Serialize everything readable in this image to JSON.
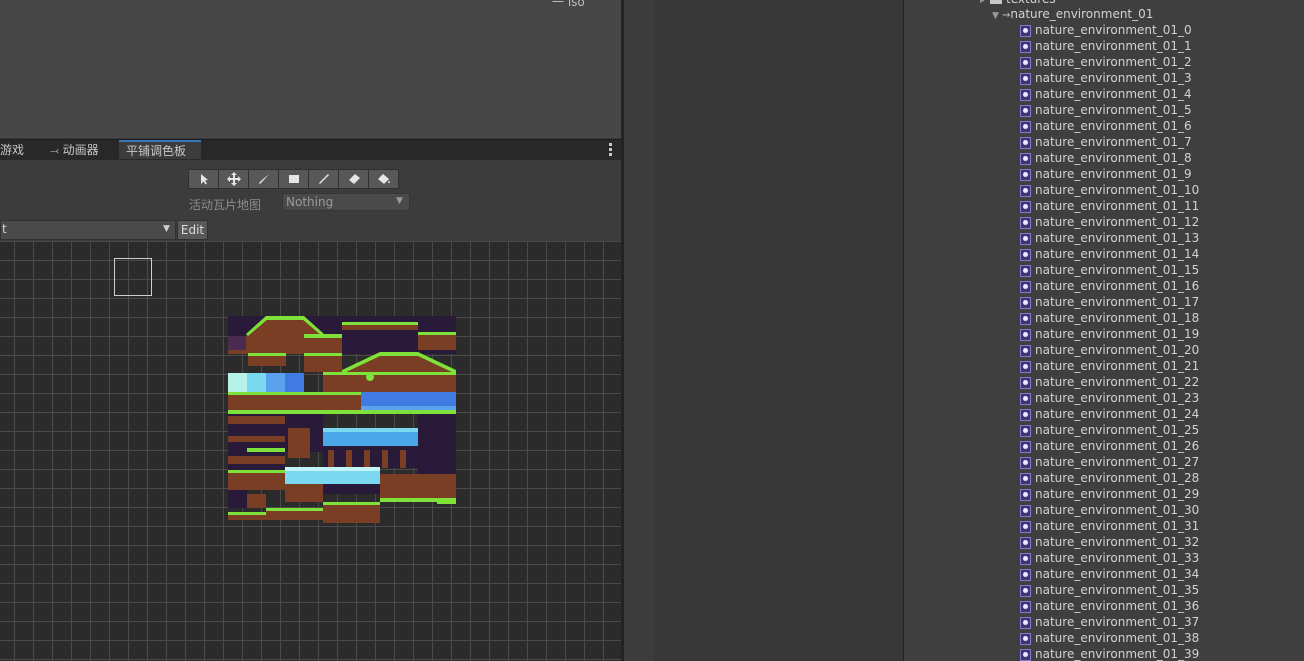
{
  "scene_top": {
    "label": "一 iso"
  },
  "tabs": [
    {
      "label": "游戏",
      "icon": "game-icon",
      "active": false
    },
    {
      "label": "动画器",
      "icon": "animator-icon",
      "active": false
    },
    {
      "label": "平铺调色板",
      "icon": "",
      "active": true
    }
  ],
  "palette": {
    "tools": [
      "select-tool-icon",
      "move-tool-icon",
      "paint-brush-icon",
      "box-fill-icon",
      "pick-icon",
      "eraser-icon",
      "fill-bucket-icon"
    ],
    "active_tilemap_label": "活动瓦片地图",
    "active_tilemap_value": "Nothing",
    "palette_name_partial": "t",
    "edit_label": "Edit"
  },
  "project": {
    "folder_partial": "textures",
    "asset_name": "nature_environment_01",
    "sprites": [
      "nature_environment_01_0",
      "nature_environment_01_1",
      "nature_environment_01_2",
      "nature_environment_01_3",
      "nature_environment_01_4",
      "nature_environment_01_5",
      "nature_environment_01_6",
      "nature_environment_01_7",
      "nature_environment_01_8",
      "nature_environment_01_9",
      "nature_environment_01_10",
      "nature_environment_01_11",
      "nature_environment_01_12",
      "nature_environment_01_13",
      "nature_environment_01_14",
      "nature_environment_01_15",
      "nature_environment_01_16",
      "nature_environment_01_17",
      "nature_environment_01_18",
      "nature_environment_01_19",
      "nature_environment_01_20",
      "nature_environment_01_21",
      "nature_environment_01_22",
      "nature_environment_01_23",
      "nature_environment_01_24",
      "nature_environment_01_25",
      "nature_environment_01_26",
      "nature_environment_01_27",
      "nature_environment_01_28",
      "nature_environment_01_29",
      "nature_environment_01_30",
      "nature_environment_01_31",
      "nature_environment_01_32",
      "nature_environment_01_33",
      "nature_environment_01_34",
      "nature_environment_01_35",
      "nature_environment_01_36",
      "nature_environment_01_37",
      "nature_environment_01_38",
      "nature_environment_01_39"
    ]
  },
  "colors": {
    "accent_tab": "#3a79bb",
    "sprite_icon": "#8a78d8"
  }
}
